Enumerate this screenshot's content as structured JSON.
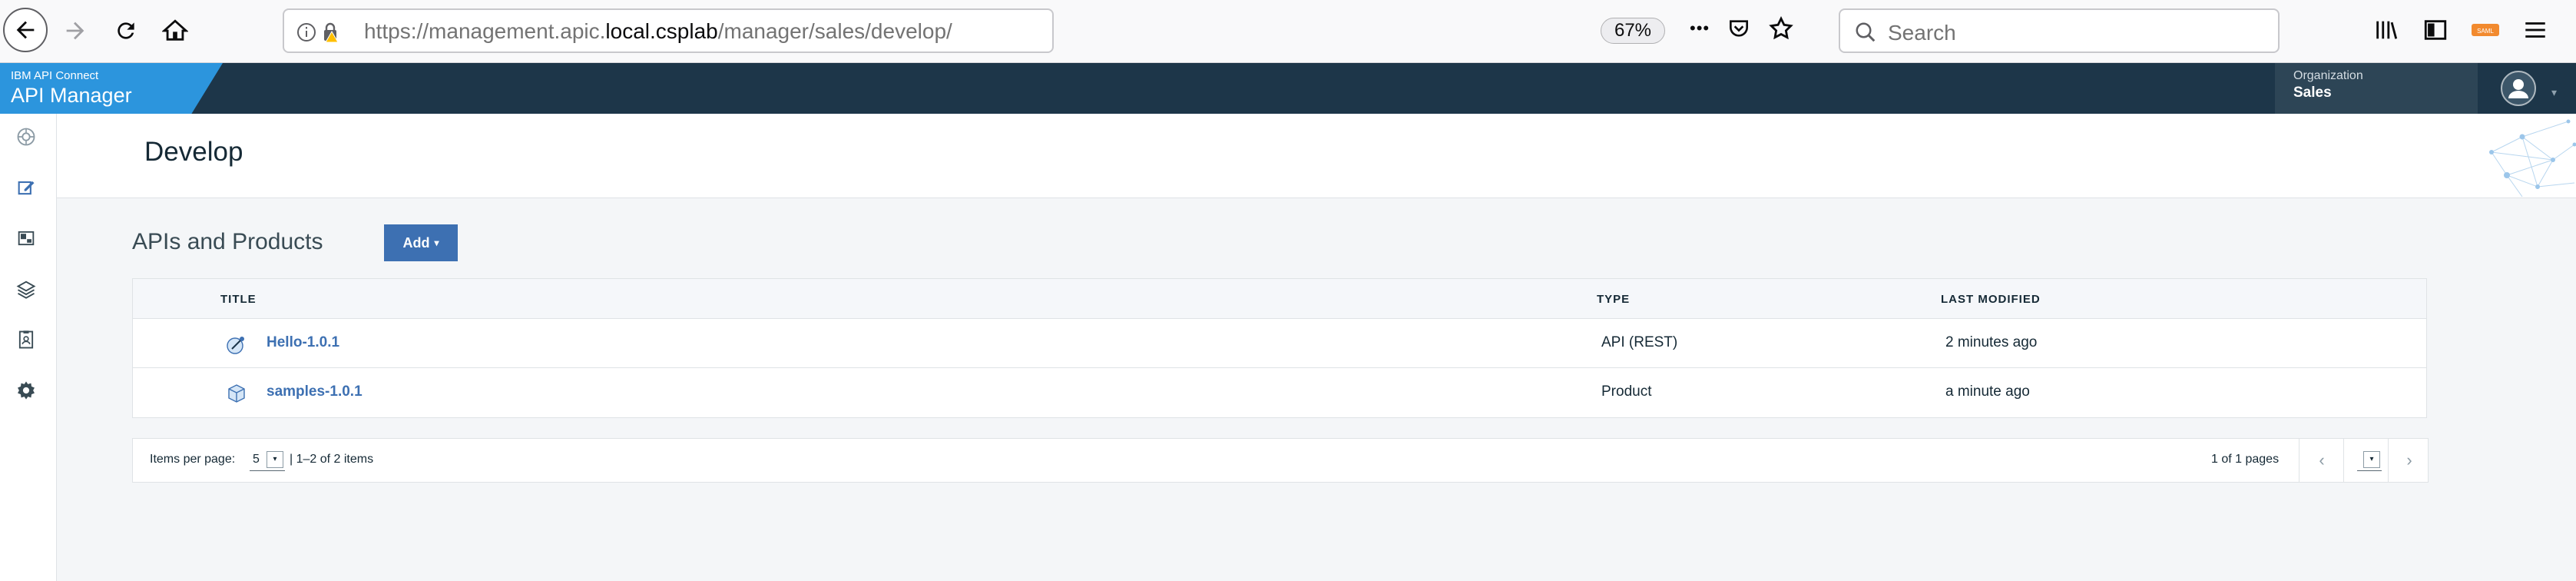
{
  "browser": {
    "url_prefix": "https://management.apic.",
    "url_host": "local.csplab",
    "url_path": "/manager/sales/develop/",
    "zoom": "67%",
    "search_placeholder": "Search",
    "menu_dots": "•••"
  },
  "app": {
    "brand_top": "IBM API Connect",
    "brand_main": "API Manager",
    "org_label": "Organization",
    "org_value": "Sales"
  },
  "page": {
    "title": "Develop"
  },
  "section": {
    "title": "APIs and Products",
    "add_label": "Add"
  },
  "table": {
    "headers": {
      "title": "TITLE",
      "type": "TYPE",
      "modified": "LAST MODIFIED"
    },
    "rows": [
      {
        "icon": "api-icon",
        "title": "Hello-1.0.1",
        "type": "API (REST)",
        "modified": "2 minutes ago"
      },
      {
        "icon": "product-icon",
        "title": "samples-1.0.1",
        "type": "Product",
        "modified": "a minute ago"
      }
    ]
  },
  "pager": {
    "items_per_page_label": "Items per page:",
    "items_per_page_value": "5",
    "range": "|  1–2 of 2 items",
    "pages": "1 of 1 pages"
  },
  "colors": {
    "header_bg": "#1d3649",
    "brand_bg": "#2c95dd",
    "accent_blue": "#3d70b2"
  }
}
